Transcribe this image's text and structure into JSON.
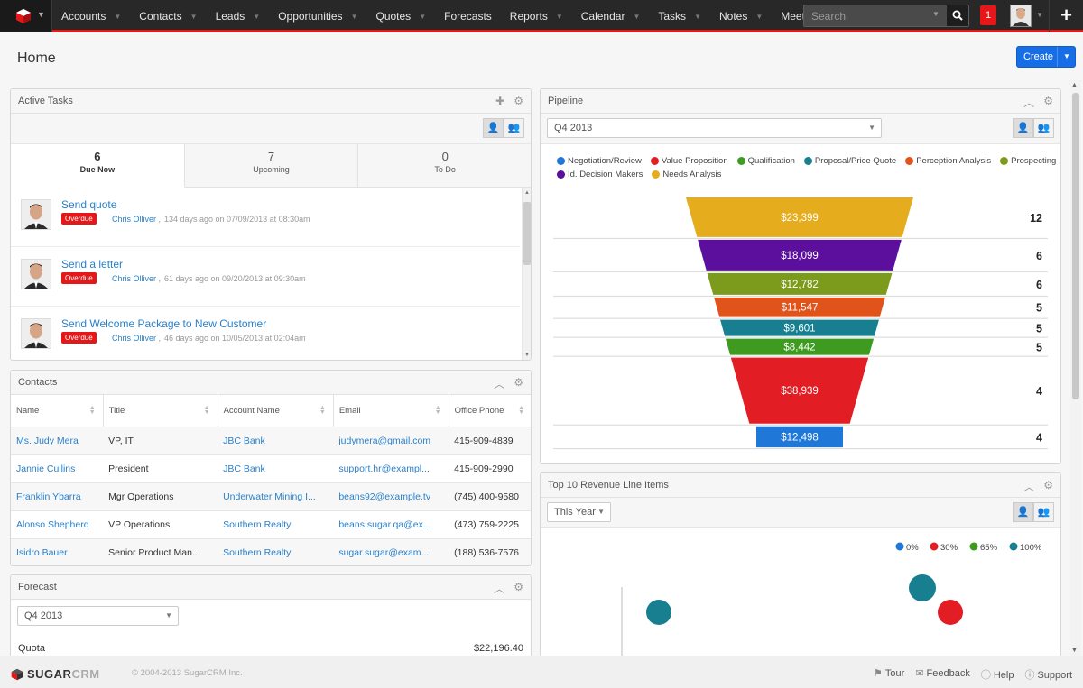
{
  "nav": {
    "items": [
      "Accounts",
      "Contacts",
      "Leads",
      "Opportunities",
      "Quotes",
      "Forecasts",
      "Reports",
      "Calendar",
      "Tasks",
      "Notes",
      "Meetings"
    ],
    "has_dropdown": [
      true,
      true,
      true,
      true,
      true,
      false,
      true,
      true,
      true,
      true,
      true
    ],
    "search_placeholder": "Search",
    "notification_count": "1"
  },
  "header": {
    "title": "Home",
    "create_label": "Create"
  },
  "active_tasks": {
    "title": "Active Tasks",
    "tabs": [
      {
        "count": "6",
        "label": "Due Now"
      },
      {
        "count": "7",
        "label": "Upcoming"
      },
      {
        "count": "0",
        "label": "To Do"
      }
    ],
    "tasks": [
      {
        "name": "Send quote",
        "status": "Overdue",
        "assignee": "Chris Olliver",
        "when": "134 days ago on 07/09/2013 at 08:30am"
      },
      {
        "name": "Send a letter",
        "status": "Overdue",
        "assignee": "Chris Olliver",
        "when": "61 days ago on 09/20/2013 at 09:30am"
      },
      {
        "name": "Send Welcome Package to New Customer",
        "status": "Overdue",
        "assignee": "Chris Olliver",
        "when": "46 days ago on 10/05/2013 at 02:04am"
      }
    ]
  },
  "contacts": {
    "title": "Contacts",
    "columns": [
      "Name",
      "Title",
      "Account Name",
      "Email",
      "Office Phone"
    ],
    "rows": [
      [
        "Ms. Judy Mera",
        "VP, IT",
        "JBC Bank",
        "judymera@gmail.com",
        "415-909-4839"
      ],
      [
        "Jannie Cullins",
        "President",
        "JBC Bank",
        "support.hr@exampl...",
        "415-909-2990"
      ],
      [
        "Franklin Ybarra",
        "Mgr Operations",
        "Underwater Mining I...",
        "beans92@example.tv",
        "(745) 400-9580"
      ],
      [
        "Alonso Shepherd",
        "VP Operations",
        "Southern Realty",
        "beans.sugar.qa@ex...",
        "(473) 759-2225"
      ],
      [
        "Isidro Bauer",
        "Senior Product Man...",
        "Southern Realty",
        "sugar.sugar@exam...",
        "(188) 536-7576"
      ]
    ]
  },
  "forecast": {
    "title": "Forecast",
    "period": "Q4 2013",
    "quota_label": "Quota",
    "quota_value": "$22,196.40"
  },
  "pipeline": {
    "title": "Pipeline",
    "period": "Q4 2013",
    "legend": [
      {
        "label": "Negotiation/Review",
        "color": "#1f77d8"
      },
      {
        "label": "Value Proposition",
        "color": "#e21d23"
      },
      {
        "label": "Qualification",
        "color": "#3f9b1f"
      },
      {
        "label": "Proposal/Price Quote",
        "color": "#177f8f"
      },
      {
        "label": "Perception Analysis",
        "color": "#e0541c"
      },
      {
        "label": "Prospecting",
        "color": "#7c9a1b"
      },
      {
        "label": "Id. Decision Makers",
        "color": "#5b0f9c"
      },
      {
        "label": "Needs Analysis",
        "color": "#e5ac1e"
      }
    ]
  },
  "chart_data": [
    {
      "type": "funnel",
      "stages": [
        {
          "label": "Needs Analysis",
          "amount": "$23,399",
          "count": 12,
          "color": "#e5ac1e"
        },
        {
          "label": "Id. Decision Makers",
          "amount": "$18,099",
          "count": 6,
          "color": "#5b0f9c"
        },
        {
          "label": "Prospecting",
          "amount": "$12,782",
          "count": 6,
          "color": "#7c9a1b"
        },
        {
          "label": "Perception Analysis",
          "amount": "$11,547",
          "count": 5,
          "color": "#e0541c"
        },
        {
          "label": "Proposal/Price Quote",
          "amount": "$9,601",
          "count": 5,
          "color": "#177f8f"
        },
        {
          "label": "Qualification",
          "amount": "$8,442",
          "count": 5,
          "color": "#3f9b1f"
        },
        {
          "label": "Value Proposition",
          "amount": "$38,939",
          "count": 4,
          "color": "#e21d23"
        },
        {
          "label": "Negotiation/Review",
          "amount": "$12,498",
          "count": 4,
          "color": "#1f77d8"
        }
      ]
    },
    {
      "type": "scatter",
      "legend": [
        {
          "label": "0%",
          "color": "#1f77d8"
        },
        {
          "label": "30%",
          "color": "#e21d23"
        },
        {
          "label": "65%",
          "color": "#3f9b1f"
        },
        {
          "label": "100%",
          "color": "#177f8f"
        }
      ]
    }
  ],
  "revenue": {
    "title": "Top 10 Revenue Line Items",
    "period": "This Year"
  },
  "footer": {
    "brand_a": "SUGAR",
    "brand_b": "CRM",
    "copyright": "© 2004-2013 SugarCRM Inc.",
    "links": [
      "Tour",
      "Feedback",
      "Help",
      "Support"
    ]
  }
}
